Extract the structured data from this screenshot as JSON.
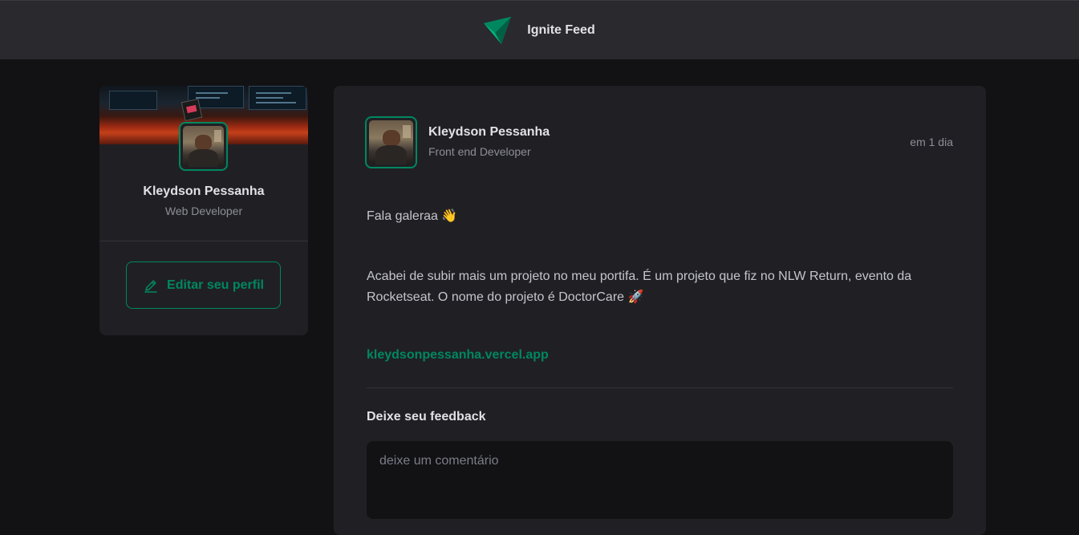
{
  "header": {
    "title": "Ignite Feed",
    "logo_icon": "paper-plane-logo-icon"
  },
  "sidebar": {
    "profile_name": "Kleydson Pessanha",
    "profile_role": "Web Developer",
    "edit_button_label": "Editar seu perfil",
    "edit_icon": "pencil-icon"
  },
  "post": {
    "author_name": "Kleydson Pessanha",
    "author_role": "Front end Developer",
    "time": "em 1 dia",
    "paragraphs": [
      "Fala galeraa 👋",
      "Acabei de subir mais um projeto no meu portifa. É um projeto que fiz no NLW Return, evento da Rocketseat. O nome do projeto é DoctorCare 🚀"
    ],
    "link": "kleydsonpessanha.vercel.app",
    "feedback_title": "Deixe seu feedback",
    "comment_placeholder": "deixe um comentário"
  },
  "colors": {
    "accent": "#00875f",
    "background": "#121214",
    "card": "#202024",
    "header": "#29292e"
  }
}
